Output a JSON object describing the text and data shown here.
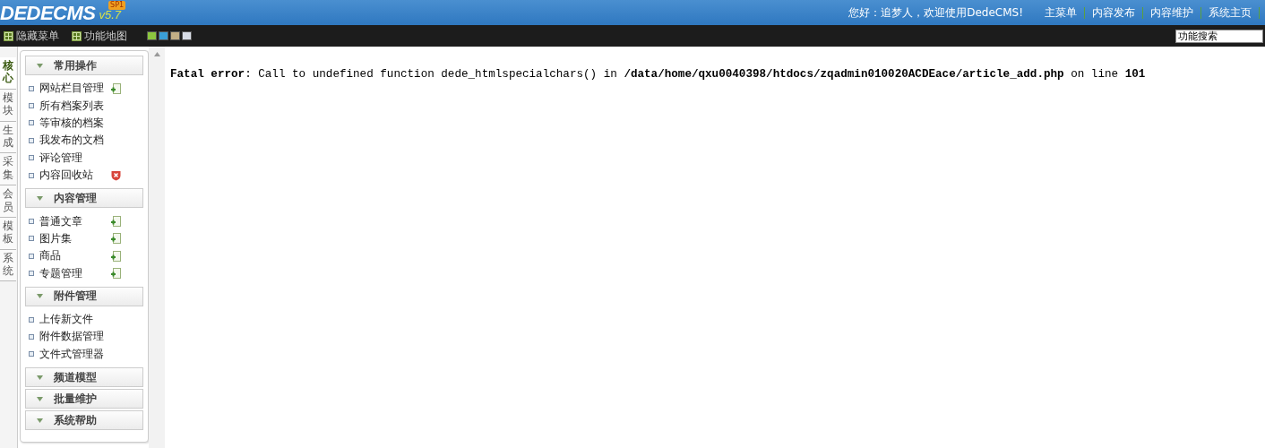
{
  "header": {
    "logo": "DEDECMS",
    "version": "v5.7",
    "edition": "SP1",
    "greeting": "您好：追梦人，欢迎使用DedeCMS!",
    "links": [
      "主菜单",
      "内容发布",
      "内容维护",
      "系统主页"
    ]
  },
  "toolbar": {
    "buttons": [
      {
        "label": "隐藏菜单"
      },
      {
        "label": "功能地图"
      }
    ],
    "skins": [
      {
        "color": "#8cc63f"
      },
      {
        "color": "#3a9fd6"
      },
      {
        "color": "#c2ae86"
      },
      {
        "color": "#d8dce6"
      }
    ],
    "search": {
      "value": "功能搜索"
    }
  },
  "side_tabs": [
    {
      "label": "核心",
      "selected": true
    },
    {
      "label": "模块",
      "selected": false
    },
    {
      "label": "生成",
      "selected": false
    },
    {
      "label": "采集",
      "selected": false
    },
    {
      "label": "会员",
      "selected": false
    },
    {
      "label": "模板",
      "selected": false
    },
    {
      "label": "系统",
      "selected": false
    }
  ],
  "menu_groups": [
    {
      "title": "常用操作",
      "items": [
        {
          "label": "网站栏目管理",
          "kind": "add"
        },
        {
          "label": "所有档案列表",
          "kind": "plain"
        },
        {
          "label": "等审核的档案",
          "kind": "plain"
        },
        {
          "label": "我发布的文档",
          "kind": "plain"
        },
        {
          "label": "评论管理",
          "kind": "plain"
        },
        {
          "label": "内容回收站",
          "kind": "delete"
        }
      ]
    },
    {
      "title": "内容管理",
      "items": [
        {
          "label": "普通文章",
          "kind": "add"
        },
        {
          "label": "图片集",
          "kind": "add"
        },
        {
          "label": "商品",
          "kind": "add"
        },
        {
          "label": "专题管理",
          "kind": "add"
        }
      ]
    },
    {
      "title": "附件管理",
      "items": [
        {
          "label": "上传新文件",
          "kind": "plain"
        },
        {
          "label": "附件数据管理",
          "kind": "plain"
        },
        {
          "label": "文件式管理器",
          "kind": "plain"
        }
      ]
    },
    {
      "title": "频道模型"
    },
    {
      "title": "批量维护"
    },
    {
      "title": "系统帮助"
    }
  ],
  "error_message": "**Fatal error**: Call to undefined function dede_htmlspecialchars() in **/data/home/qxu0040398/htdocs/zqadmin010020ACDEace/article_add.php** on line **101**"
}
